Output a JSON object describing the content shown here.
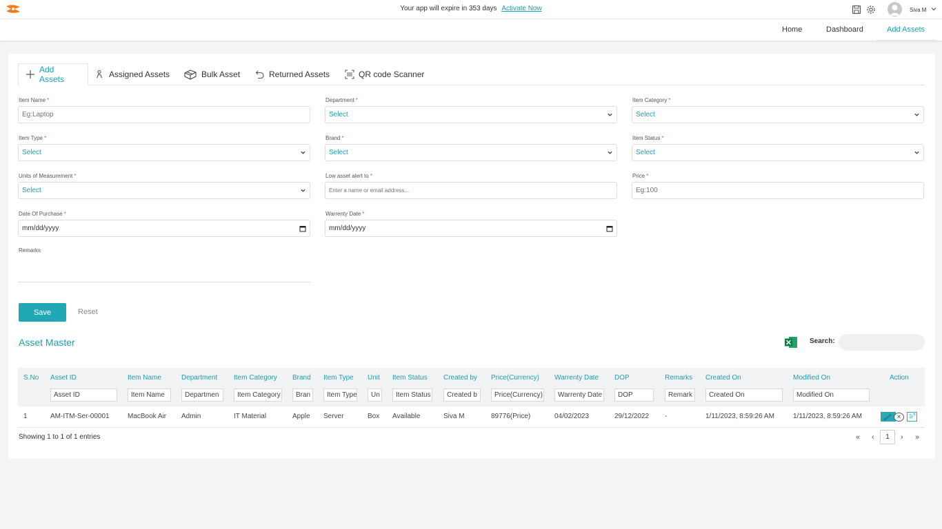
{
  "topbar": {
    "expire_text": "Your app will expire in 353 days",
    "activate_link": "Activate Now",
    "username": "Siva M"
  },
  "nav": {
    "items": [
      "Home",
      "Dashboard",
      "Add Assets"
    ],
    "active": "Add Assets"
  },
  "tabs": [
    {
      "label": "Add Assets",
      "icon": "plus-icon"
    },
    {
      "label": "Assigned Assets",
      "icon": "person-icon"
    },
    {
      "label": "Bulk Asset",
      "icon": "box-icon"
    },
    {
      "label": "Returned Assets",
      "icon": "return-arrow-icon"
    },
    {
      "label": "QR code Scanner",
      "icon": "qr-scanner-icon"
    }
  ],
  "form": {
    "item_name": {
      "label": "Item Name",
      "placeholder": "Eg:Laptop"
    },
    "department": {
      "label": "Department",
      "value": "Select"
    },
    "item_category": {
      "label": "Item Category",
      "value": "Select"
    },
    "item_type": {
      "label": "Item Type",
      "value": "Select"
    },
    "brand": {
      "label": "Brand",
      "value": "Select"
    },
    "item_status": {
      "label": "Item Status",
      "value": "Select"
    },
    "units": {
      "label": "Units of Measurement",
      "value": "Select"
    },
    "low_alert": {
      "label": "Low asset alert to",
      "placeholder": "Enter a name or email address..."
    },
    "price": {
      "label": "Price",
      "placeholder": "Eg:100"
    },
    "date_of_purchase": {
      "label": "Date Of Purchase",
      "value": "mm/dd/yyyy"
    },
    "warrenty_date": {
      "label": "Warrenty Date",
      "value": "mm/dd/yyyy"
    },
    "remarks": {
      "label": "Remarks"
    },
    "required_mark": "*",
    "save_label": "Save",
    "reset_label": "Reset"
  },
  "asset_master": {
    "title": "Asset Master",
    "search_label": "Search:",
    "columns": [
      "S.No",
      "Asset ID",
      "Item Name",
      "Department",
      "Item Category",
      "Brand",
      "Item Type",
      "Unit",
      "Item Status",
      "Created by",
      "Price(Currency)",
      "Warrenty Date",
      "DOP",
      "Remarks",
      "Created On",
      "Modified On",
      "Action"
    ],
    "filters": [
      "Asset ID",
      "Item Name",
      "Departmen",
      "Item Category",
      "Bran",
      "Item Type",
      "Un",
      "Item Status",
      "Created b",
      "Price(Currency)",
      "Warrenty Date",
      "DOP",
      "Remark",
      "Created On",
      "Modified On"
    ],
    "rows": [
      [
        "1",
        "AM-ITM-Ser-00001",
        "MacBook Air",
        "Admin",
        "IT Material",
        "Apple",
        "Server",
        "Box",
        "Available",
        "Siva M",
        "89776(Price)",
        "04/02/2023",
        "29/12/2022",
        "-",
        "1/11/2023, 8:59:26 AM",
        "1/11/2023, 8:59:26 AM"
      ]
    ],
    "close_glyph": "×",
    "showing": "Showing 1 to 1 of 1 entries",
    "pagination": {
      "first": "«",
      "prev": "‹",
      "current": "1",
      "next": "›",
      "last": "»"
    }
  },
  "colors": {
    "accent": "#1a9fb1",
    "button": "#20a9b4",
    "required": "#e25555"
  }
}
